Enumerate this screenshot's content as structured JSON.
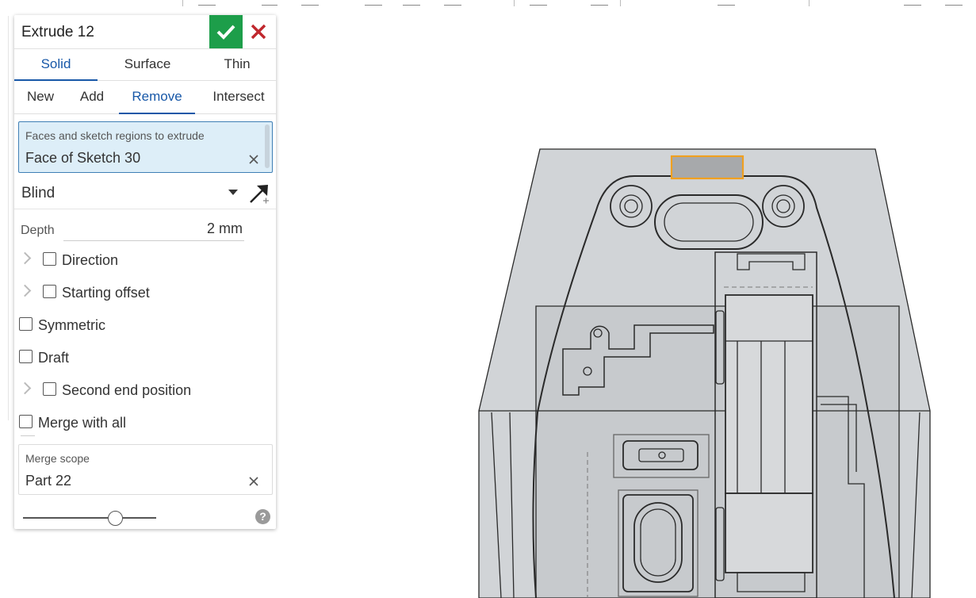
{
  "dialog": {
    "title": "Extrude 12",
    "icons": {
      "confirm": "checkmark-icon",
      "cancel": "close-x-icon",
      "flip": "flip-direction-arrow-icon",
      "help": "help-icon"
    },
    "body_type_tabs": [
      {
        "label": "Solid",
        "active": true
      },
      {
        "label": "Surface",
        "active": false
      },
      {
        "label": "Thin",
        "active": false
      }
    ],
    "operation_tabs": [
      {
        "label": "New",
        "active": false
      },
      {
        "label": "Add",
        "active": false
      },
      {
        "label": "Remove",
        "active": true
      },
      {
        "label": "Intersect",
        "active": false
      }
    ],
    "faces_field": {
      "label": "Faces and sketch regions to extrude",
      "value": "Face of Sketch 30"
    },
    "end_type": "Blind",
    "depth": {
      "label": "Depth",
      "value": "2 mm"
    },
    "options": {
      "direction": {
        "label": "Direction",
        "checked": false
      },
      "starting_offset": {
        "label": "Starting offset",
        "checked": false
      },
      "symmetric": {
        "label": "Symmetric",
        "checked": false
      },
      "draft": {
        "label": "Draft",
        "checked": false
      },
      "second_end_position": {
        "label": "Second end position",
        "checked": false
      },
      "merge_with_all": {
        "label": "Merge with all",
        "checked": false
      }
    },
    "merge_scope": {
      "label": "Merge scope",
      "value": "Part 22"
    },
    "help_glyph": "?",
    "rollback_slider_fraction": 0.7
  },
  "colors": {
    "accent": "#1858a8",
    "confirm": "#1d9e4a",
    "cancel": "#c0272d",
    "selection_highlight": "#f0a020"
  }
}
